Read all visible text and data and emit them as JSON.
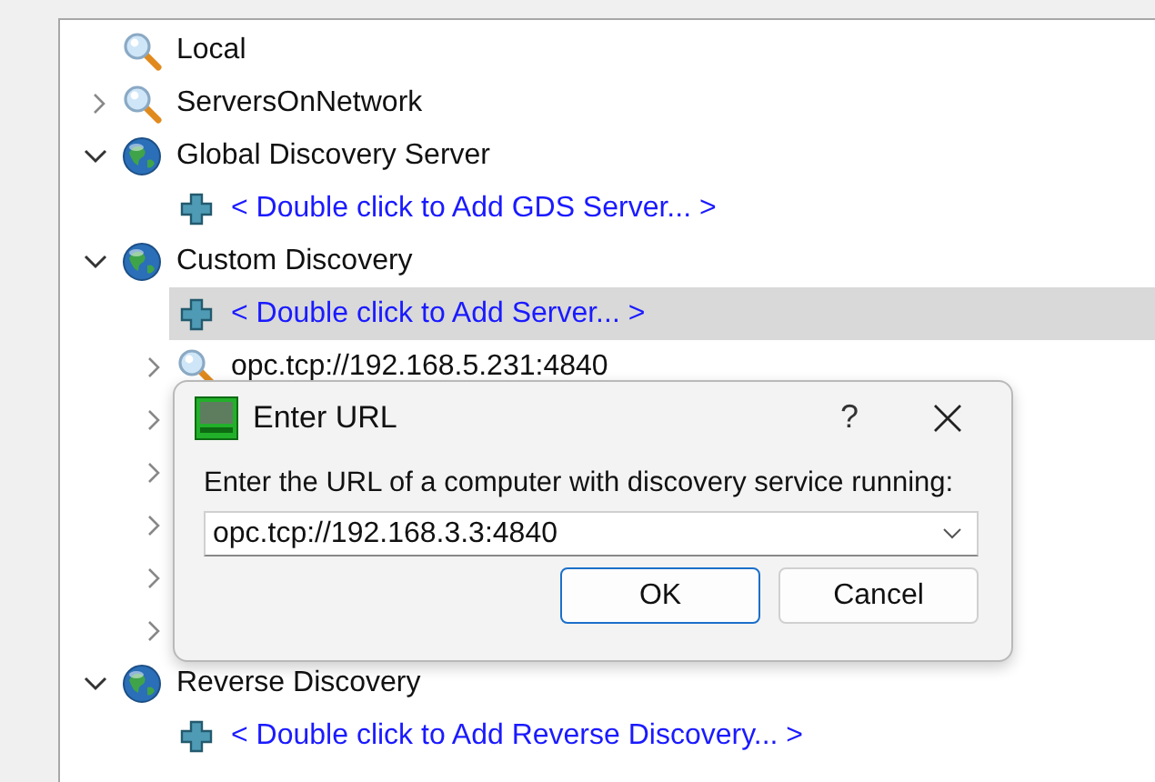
{
  "tree": [
    {
      "label": "Local",
      "kind": "search",
      "selected": false
    },
    {
      "label": "ServersOnNetwork",
      "kind": "search",
      "expanded": false,
      "selected": false
    },
    {
      "label": "Global Discovery Server",
      "kind": "globe",
      "expanded": true,
      "selected": false,
      "children": [
        {
          "label": "< Double click to Add GDS Server... >",
          "kind": "add",
          "selected": false
        }
      ]
    },
    {
      "label": "Custom Discovery",
      "kind": "globe",
      "expanded": true,
      "selected": false,
      "children": [
        {
          "label": "< Double click to Add Server... >",
          "kind": "add",
          "selected": true
        },
        {
          "label": "opc.tcp://192.168.5.231:4840",
          "kind": "search",
          "expanded": false,
          "selected": false
        },
        {
          "expanded": false
        },
        {
          "expanded": false
        },
        {
          "expanded": false
        },
        {
          "expanded": false
        },
        {
          "expanded": false
        }
      ]
    },
    {
      "label": "Reverse Discovery",
      "kind": "globe",
      "expanded": true,
      "selected": false,
      "children": [
        {
          "label": "< Double click to Add Reverse Discovery... >",
          "kind": "add",
          "selected": false
        }
      ]
    }
  ],
  "dialog": {
    "title": "Enter URL",
    "help": "?",
    "prompt": "Enter the URL of a computer with discovery service running:",
    "url": {
      "value": "opc.tcp://192.168.3.3:4840"
    },
    "buttons": [
      {
        "label": "OK",
        "default": true
      },
      {
        "label": "Cancel",
        "default": false
      }
    ]
  }
}
